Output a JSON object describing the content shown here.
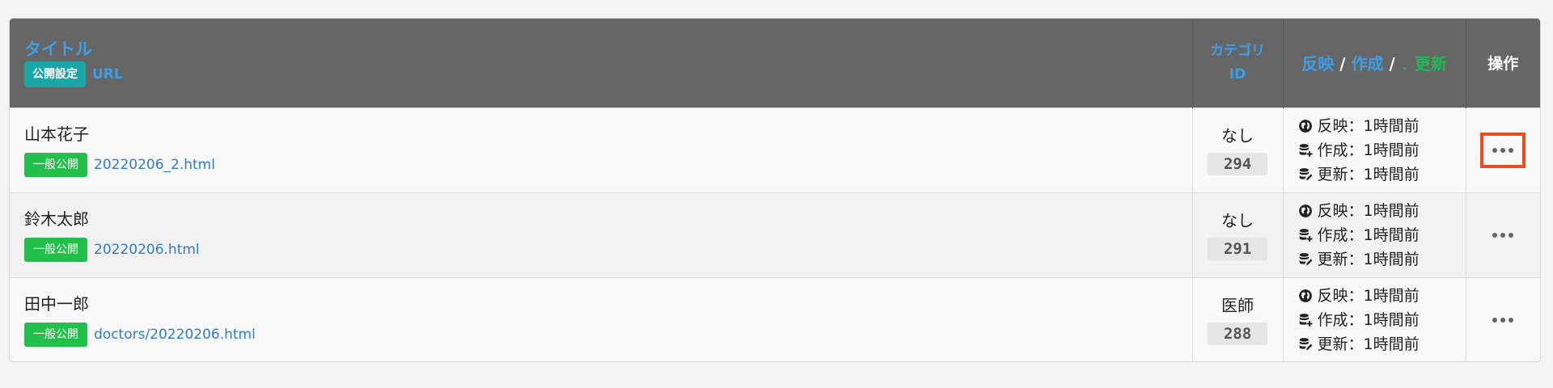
{
  "header": {
    "title_label": "タイトル",
    "public_setting_label": "公開設定",
    "url_label": "URL",
    "category_label": "カテゴリ",
    "id_label": "ID",
    "reflect_label": "反映",
    "create_label": "作成",
    "update_label": "更新",
    "slash": "/",
    "ops_label": "操作",
    "sort_indicator": "chevron-down-icon"
  },
  "rows": [
    {
      "name": "山本花子",
      "status": "一般公開",
      "file": "20220206_2.html",
      "category": "なし",
      "id": "294",
      "reflect": "反映：1時間前",
      "create": "作成：1時間前",
      "update": "更新：1時間前",
      "highlighted": true
    },
    {
      "name": "鈴木太郎",
      "status": "一般公開",
      "file": "20220206.html",
      "category": "なし",
      "id": "291",
      "reflect": "反映：1時間前",
      "create": "作成：1時間前",
      "update": "更新：1時間前",
      "highlighted": false
    },
    {
      "name": "田中一郎",
      "status": "一般公開",
      "file": "doctors/20220206.html",
      "category": "医師",
      "id": "288",
      "reflect": "反映：1時間前",
      "create": "作成：1時間前",
      "update": "更新：1時間前",
      "highlighted": false
    }
  ],
  "colors": {
    "header_bg": "#666666",
    "link_blue": "#3d9ee6",
    "status_green": "#22bf4a",
    "teal_badge": "#1aa6a6",
    "highlight_border": "#f04a1a"
  }
}
